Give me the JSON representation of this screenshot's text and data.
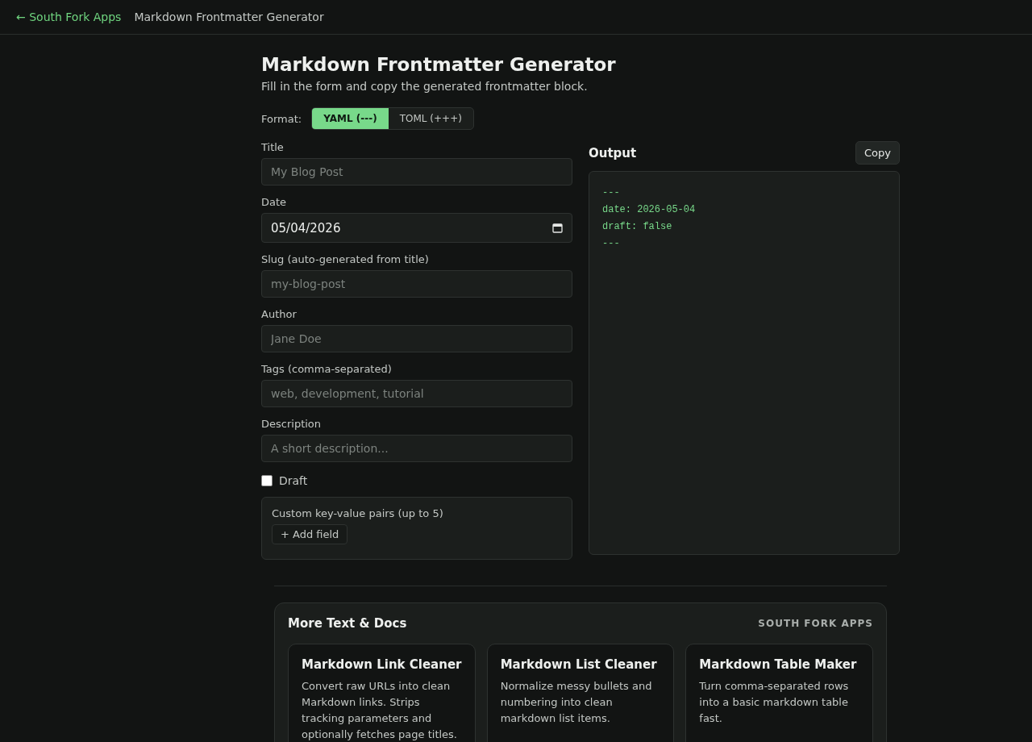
{
  "nav": {
    "back_link": "← South Fork Apps",
    "page_title": "Markdown Frontmatter Generator"
  },
  "header": {
    "title": "Markdown Frontmatter Generator",
    "subtitle": "Fill in the form and copy the generated frontmatter block."
  },
  "format": {
    "label": "Format:",
    "options": [
      {
        "label": "YAML (---)",
        "selected": true
      },
      {
        "label": "TOML (+++)",
        "selected": false
      }
    ]
  },
  "fields": [
    {
      "kind": "text",
      "label": "Title",
      "placeholder": "My Blog Post"
    },
    {
      "kind": "date",
      "label": "Date",
      "value": "05/04/2026"
    },
    {
      "kind": "text",
      "label": "Slug (auto-generated from title)",
      "placeholder": "my-blog-post"
    },
    {
      "kind": "text",
      "label": "Author",
      "placeholder": "Jane Doe"
    },
    {
      "kind": "text",
      "label": "Tags (comma-separated)",
      "placeholder": "web, development, tutorial"
    },
    {
      "kind": "text",
      "label": "Description",
      "placeholder": "A short description..."
    }
  ],
  "draft": {
    "label": "Draft",
    "checked": false
  },
  "custom": {
    "label": "Custom key-value pairs (up to 5)",
    "add_button": "+ Add field"
  },
  "output": {
    "title": "Output",
    "copy_button": "Copy",
    "lines": [
      "---",
      "date: 2026-05-04",
      "draft: false",
      "---"
    ]
  },
  "more": {
    "title": "More Text & Docs",
    "brand": "SOUTH FORK APPS",
    "cards": [
      {
        "title": "Markdown Link Cleaner",
        "description": "Convert raw URLs into clean Markdown links. Strips tracking parameters and optionally fetches page titles."
      },
      {
        "title": "Markdown List Cleaner",
        "description": "Normalize messy bullets and numbering into clean markdown list items."
      },
      {
        "title": "Markdown Table Maker",
        "description": "Turn comma-separated rows into a basic markdown table fast."
      }
    ]
  }
}
